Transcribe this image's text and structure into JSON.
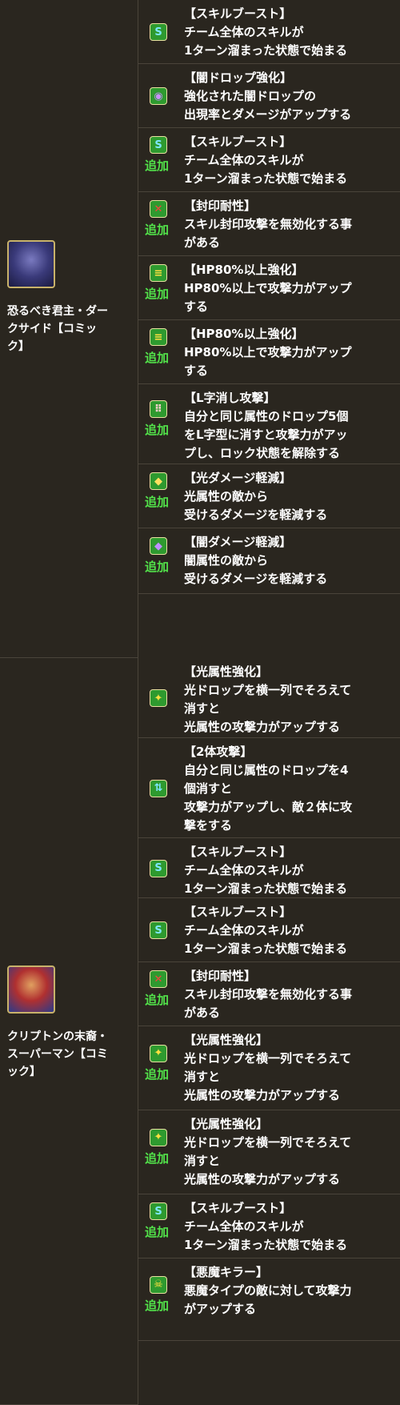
{
  "colors": {
    "background": "#2a261f",
    "border": "#4a443a",
    "tag_green": "#52e24a"
  },
  "monsters": [
    {
      "name": "恐るべき君主・ダークサイド【コミック】",
      "name_lines": [
        "恐るべき君主・ダー",
        "クサイド【コミッ",
        "ク】"
      ],
      "icon": "darkseid-portrait-icon",
      "abilities": [
        {
          "icon": "skill-boost-icon",
          "tag": "",
          "title": "【スキルブースト】",
          "desc": "チーム全体のスキルが\n1ターン溜まった状態で始まる"
        },
        {
          "icon": "dark-drop-enhance-icon",
          "tag": "",
          "title": "【闇ドロップ強化】",
          "desc": "強化された闇ドロップの\n出現率とダメージがアップする"
        },
        {
          "icon": "skill-boost-icon",
          "tag": "追加",
          "title": "【スキルブースト】",
          "desc": "チーム全体のスキルが\n1ターン溜まった状態で始まる"
        },
        {
          "icon": "seal-resist-icon",
          "tag": "追加",
          "title": "【封印耐性】",
          "desc": "スキル封印攻撃を無効化する事\nがある"
        },
        {
          "icon": "hp80-enhance-icon",
          "tag": "追加",
          "title": "【HP80%以上強化】",
          "desc": "HP80%以上で攻撃力がアップ\nする"
        },
        {
          "icon": "hp80-enhance-icon",
          "tag": "追加",
          "title": "【HP80%以上強化】",
          "desc": "HP80%以上で攻撃力がアップ\nする"
        },
        {
          "icon": "l-shape-attack-icon",
          "tag": "追加",
          "title": "【L字消し攻撃】",
          "desc": "自分と同じ属性のドロップ5個\nをL字型に消すと攻撃力がアッ\nプし、ロック状態を解除する"
        },
        {
          "icon": "light-damage-reduce-icon",
          "tag": "追加",
          "title": "【光ダメージ軽減】",
          "desc": "光属性の敵から\n受けるダメージを軽減する"
        },
        {
          "icon": "dark-damage-reduce-icon",
          "tag": "追加",
          "title": "【闇ダメージ軽減】",
          "desc": "闇属性の敵から\n受けるダメージを軽減する"
        }
      ]
    },
    {
      "name": "クリプトンの末裔・スーパーマン【コミック】",
      "name_lines": [
        "クリプトンの末裔・",
        "スーパーマン【コミ",
        "ック】"
      ],
      "icon": "superman-portrait-icon",
      "abilities": [
        {
          "icon": "light-row-enhance-icon",
          "tag": "",
          "title": "【光属性強化】",
          "desc": "光ドロップを横一列でそろえて\n消すと\n光属性の攻撃力がアップする"
        },
        {
          "icon": "two-way-attack-icon",
          "tag": "",
          "title": "【2体攻撃】",
          "desc": "自分と同じ属性のドロップを4\n個消すと\n攻撃力がアップし、敵２体に攻\n撃をする"
        },
        {
          "icon": "skill-boost-icon",
          "tag": "",
          "title": "【スキルブースト】",
          "desc": "チーム全体のスキルが\n1ターン溜まった状態で始まる"
        },
        {
          "icon": "skill-boost-icon",
          "tag": "",
          "title": "【スキルブースト】",
          "desc": "チーム全体のスキルが\n1ターン溜まった状態で始まる"
        },
        {
          "icon": "seal-resist-icon",
          "tag": "追加",
          "title": "【封印耐性】",
          "desc": "スキル封印攻撃を無効化する事\nがある"
        },
        {
          "icon": "light-row-enhance-icon",
          "tag": "追加",
          "title": "【光属性強化】",
          "desc": "光ドロップを横一列でそろえて\n消すと\n光属性の攻撃力がアップする"
        },
        {
          "icon": "light-row-enhance-icon",
          "tag": "追加",
          "title": "【光属性強化】",
          "desc": "光ドロップを横一列でそろえて\n消すと\n光属性の攻撃力がアップする"
        },
        {
          "icon": "skill-boost-icon",
          "tag": "追加",
          "title": "【スキルブースト】",
          "desc": "チーム全体のスキルが\n1ターン溜まった状態で始まる"
        },
        {
          "icon": "devil-killer-icon",
          "tag": "追加",
          "title": "【悪魔キラー】",
          "desc": "悪魔タイプの敵に対して攻撃力\nがアップする"
        }
      ]
    }
  ]
}
